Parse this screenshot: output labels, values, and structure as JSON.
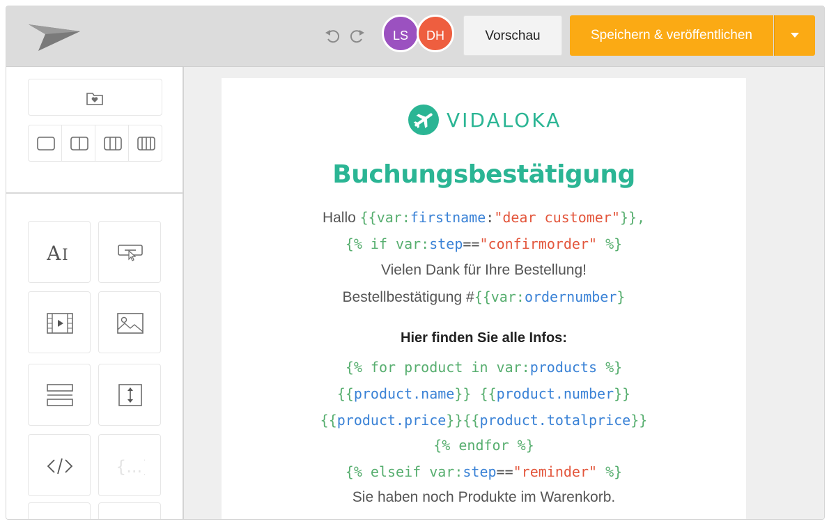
{
  "toolbar": {
    "undo_icon": "undo-icon",
    "redo_icon": "redo-icon",
    "users": [
      {
        "initials": "LS",
        "color": "#9b51c0"
      },
      {
        "initials": "DH",
        "color": "#ee5e3f"
      }
    ],
    "preview_label": "Vorschau",
    "publish_label": "Speichern & veröffentlichen",
    "accent_color": "#fbaa14"
  },
  "sidebar": {
    "saved_icon": "folder-heart-icon",
    "layouts": [
      "one-column-icon",
      "two-column-icon",
      "three-column-icon",
      "four-column-icon"
    ],
    "tools": [
      "text-icon",
      "button-icon",
      "video-icon",
      "image-icon",
      "divider-icon",
      "spacer-icon",
      "html-code-icon",
      "dynamic-content-icon"
    ]
  },
  "email": {
    "brand": "VIDALOKA",
    "brand_color": "#2bb594",
    "heading": "Buchungsbestätigung",
    "greeting": "Hallo",
    "l1_open": "{{var:",
    "l1_var": "firstname",
    "l1_colon": ":",
    "l1_str": "\"dear customer\"",
    "l1_close": "}},",
    "l2_open": "{% if var:",
    "l2_var": "step",
    "l2_eq": "==",
    "l2_str": "\"confirmorder\"",
    "l2_close": " %}",
    "thanks": "Vielen Dank für Ihre Bestellung!",
    "order_label": "Bestellbestätigung #",
    "l4_open": "{{var:",
    "l4_var": "ordernumber",
    "l4_close": "}",
    "info_heading": "Hier finden Sie alle Infos:",
    "l6_open": "{% for product in var:",
    "l6_var": "products",
    "l6_close": " %}",
    "l7_a_open": "{{",
    "l7_a_var": "product.name",
    "l7_a_close": "}} ",
    "l7_b_open": "{{",
    "l7_b_var": "product.number",
    "l7_b_close": "}}",
    "l8_a_open": "{{",
    "l8_a_var": "product.price",
    "l8_a_close": "}}",
    "l8_b_open": "{{",
    "l8_b_var": "product.totalprice",
    "l8_b_close": "}}",
    "l9": "{% endfor %}",
    "l10_open": "{% elseif var:",
    "l10_var": "step",
    "l10_eq": "==",
    "l10_str": "\"reminder\"",
    "l10_close": " %}",
    "reminder_text": "Sie haben noch Produkte im Warenkorb."
  }
}
